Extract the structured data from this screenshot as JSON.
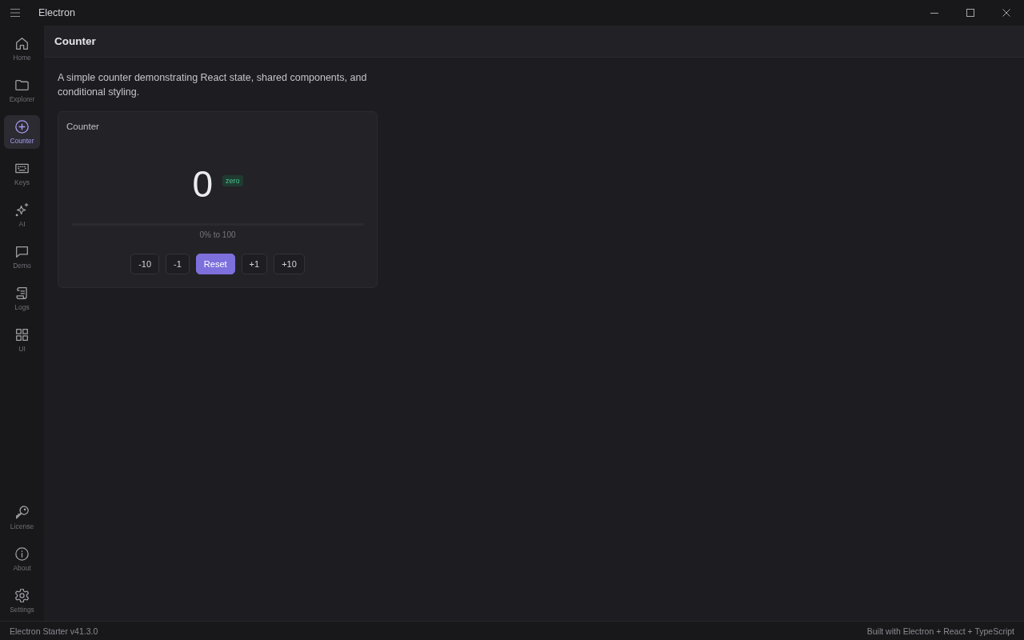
{
  "window": {
    "title": "Electron"
  },
  "sidebar": {
    "items": [
      {
        "label": "Home",
        "selected": false
      },
      {
        "label": "Explorer",
        "selected": false
      },
      {
        "label": "Counter",
        "selected": true
      },
      {
        "label": "Keys",
        "selected": false
      },
      {
        "label": "AI",
        "selected": false
      },
      {
        "label": "Demo",
        "selected": false
      },
      {
        "label": "Logs",
        "selected": false
      },
      {
        "label": "UI",
        "selected": false
      }
    ],
    "bottom_items": [
      {
        "label": "License",
        "selected": false
      },
      {
        "label": "About",
        "selected": false
      },
      {
        "label": "Settings",
        "selected": false
      }
    ]
  },
  "page": {
    "title": "Counter",
    "description": "A simple counter demonstrating React state, shared components, and conditional styling.",
    "card": {
      "title": "Counter",
      "value": "0",
      "badge": "zero",
      "range_label": "0% to 100",
      "buttons": [
        {
          "label": "-10",
          "kind": "outline"
        },
        {
          "label": "-1",
          "kind": "outline"
        },
        {
          "label": "Reset",
          "kind": "primary"
        },
        {
          "label": "+1",
          "kind": "outline"
        },
        {
          "label": "+10",
          "kind": "outline"
        }
      ]
    }
  },
  "status_bar": {
    "left": "Electron Starter v41.3.0",
    "right": "Built with Electron + React + TypeScript"
  }
}
